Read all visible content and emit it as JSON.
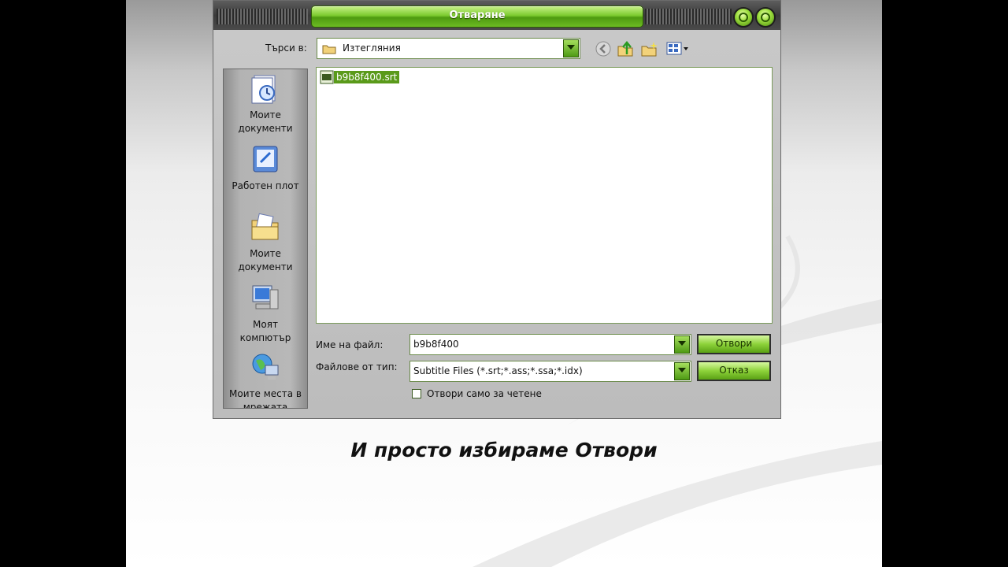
{
  "dialog": {
    "title": "Отваряне",
    "look_in_label": "Търси в:",
    "look_in_value": "Изтегляния",
    "toolbar_icons": [
      "back-icon",
      "up-folder-icon",
      "new-folder-icon",
      "view-menu-icon"
    ],
    "places": [
      {
        "label": "Моите документи",
        "icon": "my-documents-icon"
      },
      {
        "label": "Работен плот",
        "icon": "desktop-icon"
      },
      {
        "label": "Моите документи",
        "icon": "documents-folder-icon"
      },
      {
        "label": "Моят компютър",
        "icon": "my-computer-icon"
      },
      {
        "label": "Моите места в мрежата",
        "icon": "network-places-icon"
      }
    ],
    "files": [
      {
        "name": "b9b8f400.srt",
        "selected": true
      }
    ],
    "filename_label": "Име на файл:",
    "filename_value": "b9b8f400",
    "filetype_label": "Файлове от тип:",
    "filetype_value": "Subtitle Files (*.srt;*.ass;*.ssa;*.idx)",
    "readonly_label": "Отвори само за четене",
    "readonly_checked": false,
    "open_button": "Отвори",
    "cancel_button": "Отказ",
    "accent_color": "#6cbb22"
  },
  "caption": "И просто избираме Отвори"
}
